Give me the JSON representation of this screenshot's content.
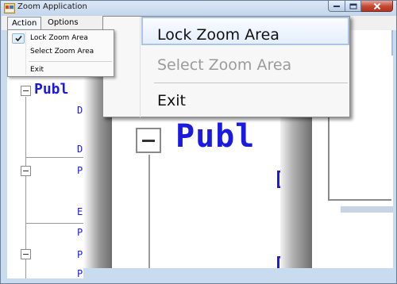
{
  "window": {
    "title": "Zoom Application",
    "icon": "app-window-icon",
    "controls": [
      "minimize-icon",
      "maximize-icon",
      "close-icon"
    ]
  },
  "menubar": {
    "items": [
      {
        "label": "Action",
        "open": true
      },
      {
        "label": "Options",
        "open": false
      }
    ]
  },
  "action_menu": {
    "items": [
      {
        "label": "Lock Zoom Area",
        "checked": true,
        "enabled": true
      },
      {
        "label": "Select Zoom Area",
        "checked": false,
        "enabled": true
      },
      {
        "label": "Exit",
        "checked": false,
        "enabled": true
      }
    ]
  },
  "zoom_view": {
    "magnified_menu": {
      "items": [
        {
          "label": "Lock Zoom Area",
          "highlighted": true
        },
        {
          "label": "Select Zoom Area",
          "enabled": false
        },
        {
          "label": "Exit"
        }
      ]
    },
    "code_text_large": "Publ",
    "code_text_large_2": "Publi",
    "code_fragment_large": "D"
  },
  "background_tree": {
    "code_text": "Publ",
    "fragments": [
      "D",
      "D",
      "P",
      "E",
      "P",
      "P",
      "P"
    ]
  }
}
